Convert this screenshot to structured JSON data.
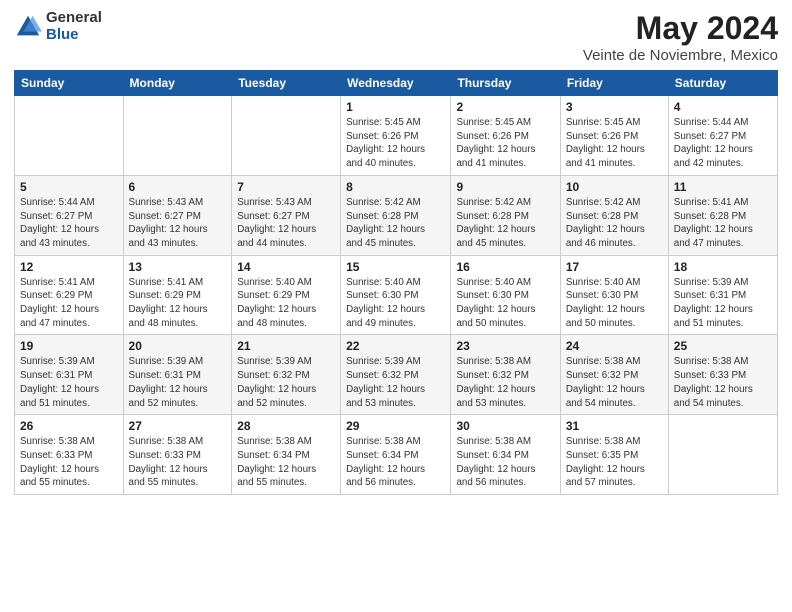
{
  "logo": {
    "general": "General",
    "blue": "Blue"
  },
  "header": {
    "month_year": "May 2024",
    "location": "Veinte de Noviembre, Mexico"
  },
  "days_of_week": [
    "Sunday",
    "Monday",
    "Tuesday",
    "Wednesday",
    "Thursday",
    "Friday",
    "Saturday"
  ],
  "weeks": [
    [
      {
        "day": "",
        "info": ""
      },
      {
        "day": "",
        "info": ""
      },
      {
        "day": "",
        "info": ""
      },
      {
        "day": "1",
        "info": "Sunrise: 5:45 AM\nSunset: 6:26 PM\nDaylight: 12 hours\nand 40 minutes."
      },
      {
        "day": "2",
        "info": "Sunrise: 5:45 AM\nSunset: 6:26 PM\nDaylight: 12 hours\nand 41 minutes."
      },
      {
        "day": "3",
        "info": "Sunrise: 5:45 AM\nSunset: 6:26 PM\nDaylight: 12 hours\nand 41 minutes."
      },
      {
        "day": "4",
        "info": "Sunrise: 5:44 AM\nSunset: 6:27 PM\nDaylight: 12 hours\nand 42 minutes."
      }
    ],
    [
      {
        "day": "5",
        "info": "Sunrise: 5:44 AM\nSunset: 6:27 PM\nDaylight: 12 hours\nand 43 minutes."
      },
      {
        "day": "6",
        "info": "Sunrise: 5:43 AM\nSunset: 6:27 PM\nDaylight: 12 hours\nand 43 minutes."
      },
      {
        "day": "7",
        "info": "Sunrise: 5:43 AM\nSunset: 6:27 PM\nDaylight: 12 hours\nand 44 minutes."
      },
      {
        "day": "8",
        "info": "Sunrise: 5:42 AM\nSunset: 6:28 PM\nDaylight: 12 hours\nand 45 minutes."
      },
      {
        "day": "9",
        "info": "Sunrise: 5:42 AM\nSunset: 6:28 PM\nDaylight: 12 hours\nand 45 minutes."
      },
      {
        "day": "10",
        "info": "Sunrise: 5:42 AM\nSunset: 6:28 PM\nDaylight: 12 hours\nand 46 minutes."
      },
      {
        "day": "11",
        "info": "Sunrise: 5:41 AM\nSunset: 6:28 PM\nDaylight: 12 hours\nand 47 minutes."
      }
    ],
    [
      {
        "day": "12",
        "info": "Sunrise: 5:41 AM\nSunset: 6:29 PM\nDaylight: 12 hours\nand 47 minutes."
      },
      {
        "day": "13",
        "info": "Sunrise: 5:41 AM\nSunset: 6:29 PM\nDaylight: 12 hours\nand 48 minutes."
      },
      {
        "day": "14",
        "info": "Sunrise: 5:40 AM\nSunset: 6:29 PM\nDaylight: 12 hours\nand 48 minutes."
      },
      {
        "day": "15",
        "info": "Sunrise: 5:40 AM\nSunset: 6:30 PM\nDaylight: 12 hours\nand 49 minutes."
      },
      {
        "day": "16",
        "info": "Sunrise: 5:40 AM\nSunset: 6:30 PM\nDaylight: 12 hours\nand 50 minutes."
      },
      {
        "day": "17",
        "info": "Sunrise: 5:40 AM\nSunset: 6:30 PM\nDaylight: 12 hours\nand 50 minutes."
      },
      {
        "day": "18",
        "info": "Sunrise: 5:39 AM\nSunset: 6:31 PM\nDaylight: 12 hours\nand 51 minutes."
      }
    ],
    [
      {
        "day": "19",
        "info": "Sunrise: 5:39 AM\nSunset: 6:31 PM\nDaylight: 12 hours\nand 51 minutes."
      },
      {
        "day": "20",
        "info": "Sunrise: 5:39 AM\nSunset: 6:31 PM\nDaylight: 12 hours\nand 52 minutes."
      },
      {
        "day": "21",
        "info": "Sunrise: 5:39 AM\nSunset: 6:32 PM\nDaylight: 12 hours\nand 52 minutes."
      },
      {
        "day": "22",
        "info": "Sunrise: 5:39 AM\nSunset: 6:32 PM\nDaylight: 12 hours\nand 53 minutes."
      },
      {
        "day": "23",
        "info": "Sunrise: 5:38 AM\nSunset: 6:32 PM\nDaylight: 12 hours\nand 53 minutes."
      },
      {
        "day": "24",
        "info": "Sunrise: 5:38 AM\nSunset: 6:32 PM\nDaylight: 12 hours\nand 54 minutes."
      },
      {
        "day": "25",
        "info": "Sunrise: 5:38 AM\nSunset: 6:33 PM\nDaylight: 12 hours\nand 54 minutes."
      }
    ],
    [
      {
        "day": "26",
        "info": "Sunrise: 5:38 AM\nSunset: 6:33 PM\nDaylight: 12 hours\nand 55 minutes."
      },
      {
        "day": "27",
        "info": "Sunrise: 5:38 AM\nSunset: 6:33 PM\nDaylight: 12 hours\nand 55 minutes."
      },
      {
        "day": "28",
        "info": "Sunrise: 5:38 AM\nSunset: 6:34 PM\nDaylight: 12 hours\nand 55 minutes."
      },
      {
        "day": "29",
        "info": "Sunrise: 5:38 AM\nSunset: 6:34 PM\nDaylight: 12 hours\nand 56 minutes."
      },
      {
        "day": "30",
        "info": "Sunrise: 5:38 AM\nSunset: 6:34 PM\nDaylight: 12 hours\nand 56 minutes."
      },
      {
        "day": "31",
        "info": "Sunrise: 5:38 AM\nSunset: 6:35 PM\nDaylight: 12 hours\nand 57 minutes."
      },
      {
        "day": "",
        "info": ""
      }
    ]
  ]
}
